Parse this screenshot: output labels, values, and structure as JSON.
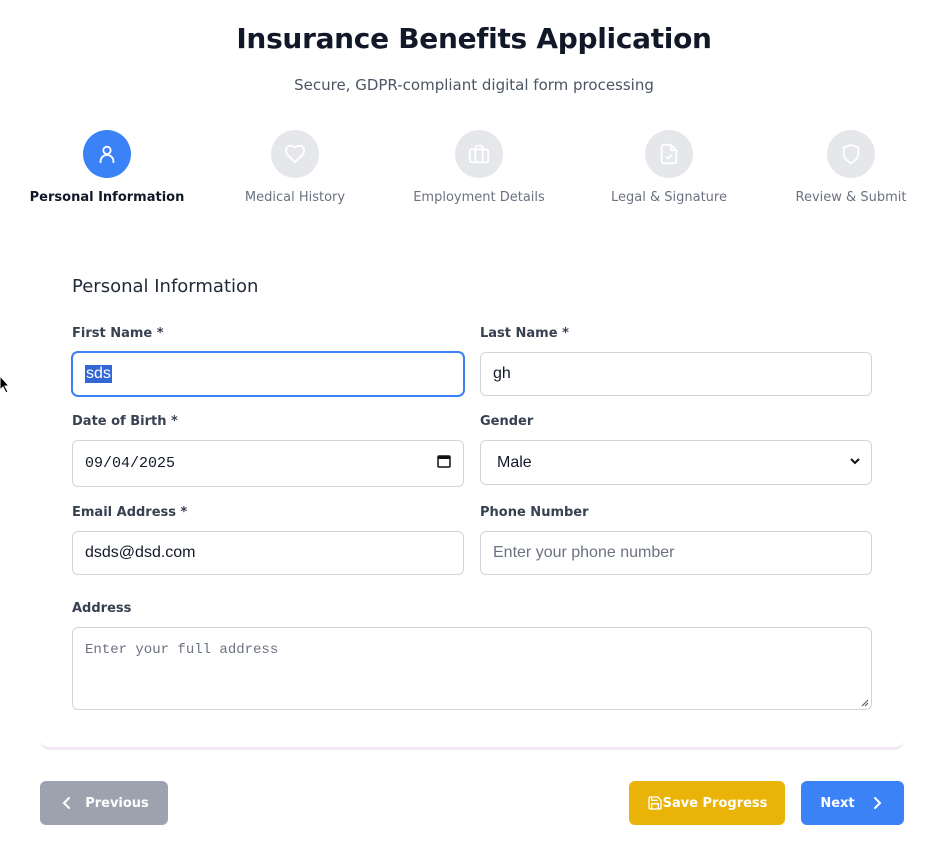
{
  "header": {
    "title": "Insurance Benefits Application",
    "subtitle": "Secure, GDPR-compliant digital form processing"
  },
  "steps": [
    {
      "label": "Personal Information",
      "icon": "user-icon",
      "active": true
    },
    {
      "label": "Medical History",
      "icon": "heart-icon",
      "active": false
    },
    {
      "label": "Employment Details",
      "icon": "briefcase-icon",
      "active": false
    },
    {
      "label": "Legal & Signature",
      "icon": "file-check-icon",
      "active": false
    },
    {
      "label": "Review & Submit",
      "icon": "shield-icon",
      "active": false
    }
  ],
  "form": {
    "section_title": "Personal Information",
    "first_name": {
      "label": "First Name *",
      "value": "sds"
    },
    "last_name": {
      "label": "Last Name *",
      "value": "gh"
    },
    "dob": {
      "label": "Date of Birth *",
      "value": "09/04/2025"
    },
    "gender": {
      "label": "Gender",
      "value": "Male"
    },
    "email": {
      "label": "Email Address *",
      "value": "dsds@dsd.com"
    },
    "phone": {
      "label": "Phone Number",
      "value": "",
      "placeholder": "Enter your phone number"
    },
    "address": {
      "label": "Address",
      "value": "",
      "placeholder": "Enter your full address"
    }
  },
  "buttons": {
    "previous": "Previous",
    "save": "Save Progress",
    "next": "Next"
  },
  "colors": {
    "primary": "#3b82f6",
    "save": "#eab308",
    "disabled": "#9ca3af",
    "step_inactive": "#e5e7eb"
  }
}
